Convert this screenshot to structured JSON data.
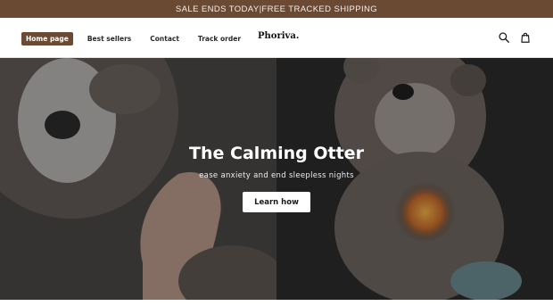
{
  "announcement": {
    "text": "SALE ENDS TODAY|FREE TRACKED SHIPPING"
  },
  "header": {
    "nav": [
      {
        "label": "Home page",
        "active": true
      },
      {
        "label": "Best sellers",
        "active": false
      },
      {
        "label": "Contact",
        "active": false
      },
      {
        "label": "Track order",
        "active": false
      }
    ],
    "logo": "Phoriva.",
    "icons": [
      "search-icon",
      "cart-icon"
    ]
  },
  "hero": {
    "title": "The Calming Otter",
    "subtitle": "ease anxiety and end sleepless nights",
    "button_label": "Learn how"
  },
  "colors": {
    "announcement_bg": "#6b4a34",
    "active_nav_bg": "#6b4a34",
    "hero_button_bg": "#ffffff"
  }
}
